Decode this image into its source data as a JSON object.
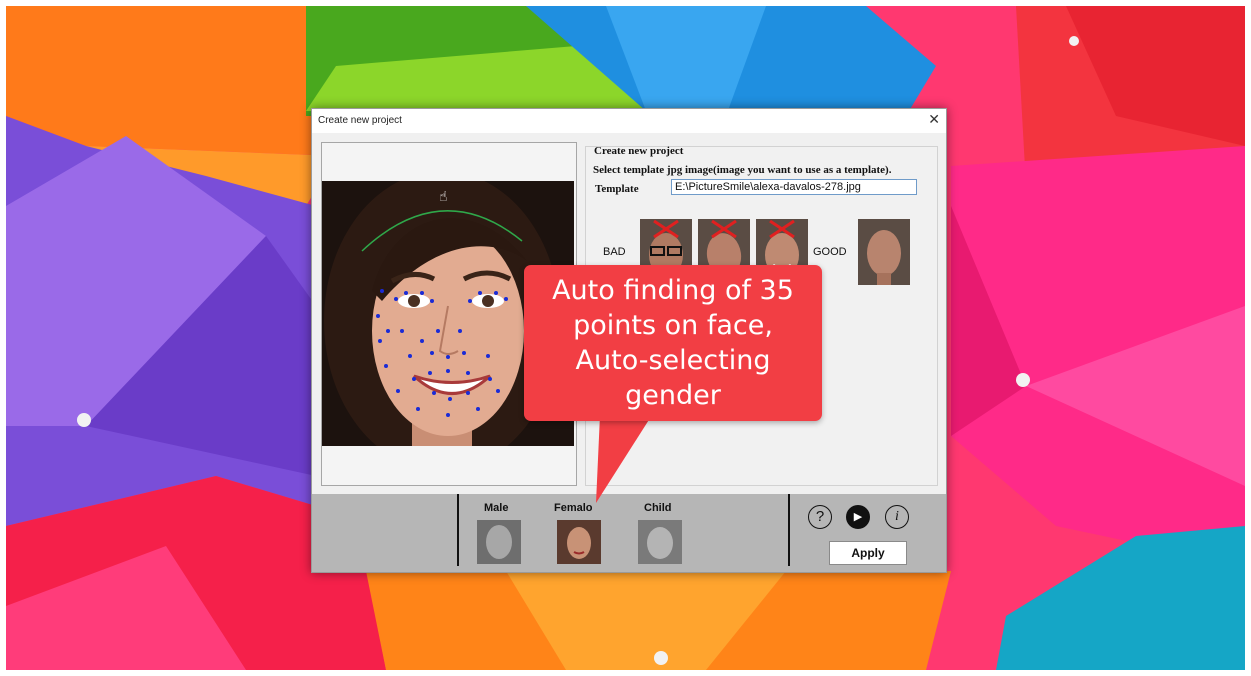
{
  "dialog": {
    "title": "Create new project",
    "close_glyph": "✕"
  },
  "form": {
    "group_title": "Create new project",
    "instruction": "Select template jpg image(image you want to use as a template).",
    "template_label": "Template",
    "template_value": "E:\\PictureSmile\\alexa-davalos-278.jpg"
  },
  "examples": {
    "bad_label": "BAD",
    "good_label": "GOOD"
  },
  "gender": {
    "male": "Male",
    "female": "Femalo",
    "child": "Child"
  },
  "buttons": {
    "help": "?",
    "play": "▶",
    "info": "i",
    "apply": "Apply"
  },
  "callout": {
    "line1": "Auto finding of 35",
    "line2": "points on face,",
    "line3": "Auto-selecting",
    "line4": "gender"
  },
  "colors": {
    "callout": "#f23e44",
    "landmark_points": "#1a2bd6",
    "footer": "#b6b6b6"
  }
}
